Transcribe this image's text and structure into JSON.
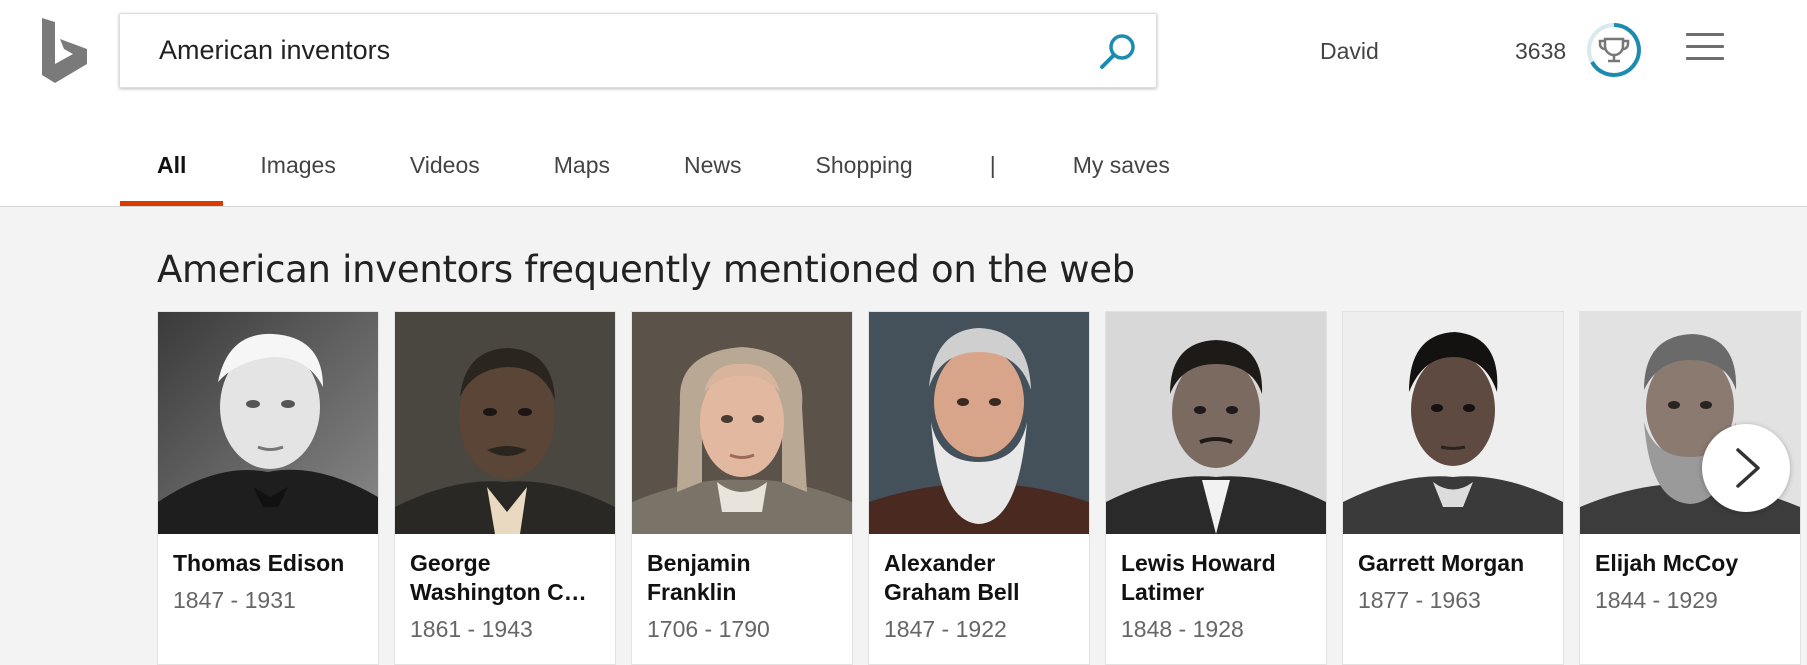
{
  "header": {
    "search_query": "American inventors",
    "user_name": "David",
    "rewards_points": "3638"
  },
  "tabs": [
    {
      "label": "All",
      "active": true
    },
    {
      "label": "Images",
      "active": false
    },
    {
      "label": "Videos",
      "active": false
    },
    {
      "label": "Maps",
      "active": false
    },
    {
      "label": "News",
      "active": false
    },
    {
      "label": "Shopping",
      "active": false
    },
    {
      "label": "|",
      "active": false
    },
    {
      "label": "My saves",
      "active": false
    }
  ],
  "section": {
    "title": "American inventors frequently mentioned on the web"
  },
  "inventors": [
    {
      "name": "Thomas Edison",
      "years": "1847 - 1931"
    },
    {
      "name": "George Washington C…",
      "years": "1861 - 1943"
    },
    {
      "name": "Benjamin Franklin",
      "years": "1706 - 1790"
    },
    {
      "name": "Alexander Graham Bell",
      "years": "1847 - 1922"
    },
    {
      "name": "Lewis Howard Latimer",
      "years": "1848 - 1928"
    },
    {
      "name": "Garrett Morgan",
      "years": "1877 - 1963"
    },
    {
      "name": "Elijah McCoy",
      "years": "1844 - 1929"
    }
  ],
  "colors": {
    "active_tab_underline": "#d83b01",
    "accent": "#1b8cb0",
    "results_background": "#f3f3f3"
  },
  "icons": {
    "logo": "bing-logo-icon",
    "search": "search-icon",
    "rewards": "trophy-icon",
    "menu": "hamburger-menu-icon",
    "next": "chevron-right-icon"
  }
}
